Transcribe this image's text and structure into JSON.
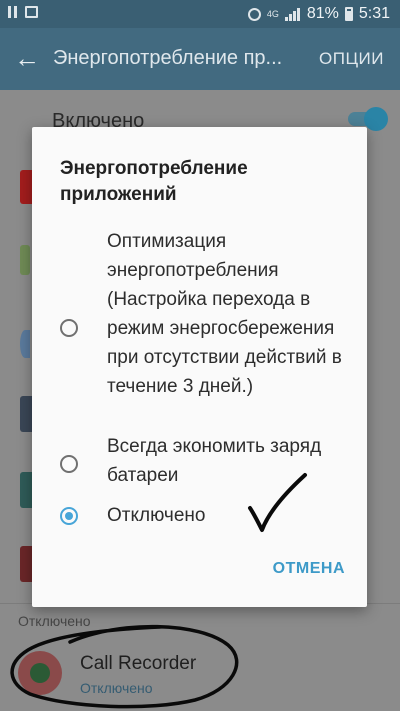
{
  "status_bar": {
    "network": "4G",
    "battery": "81%",
    "time": "5:31",
    "icons": [
      "pause-icon",
      "image-icon",
      "alarm-icon",
      "signal-icon",
      "battery-icon"
    ]
  },
  "app_bar": {
    "title": "Энергопотребление пр...",
    "options_label": "ОПЦИИ",
    "back_icon": "arrow-back-icon"
  },
  "background": {
    "toggle_label": "Включено",
    "toggle_on": true,
    "section_label": "Отключено",
    "app_name": "Call Recorder",
    "app_status": "Отключено",
    "accent_color": "#47a5d8"
  },
  "dialog": {
    "title": "Энергопотребление приложений",
    "options": [
      {
        "label": "Оптимизация энергопотребления (Настройка перехода в режим энергосбережения при отсутствии действий в течение 3 дней.)",
        "checked": false
      },
      {
        "label": "Всегда экономить заряд батареи",
        "checked": false
      },
      {
        "label": "Отключено",
        "checked": true
      }
    ],
    "cancel_label": "ОТМЕНА"
  }
}
